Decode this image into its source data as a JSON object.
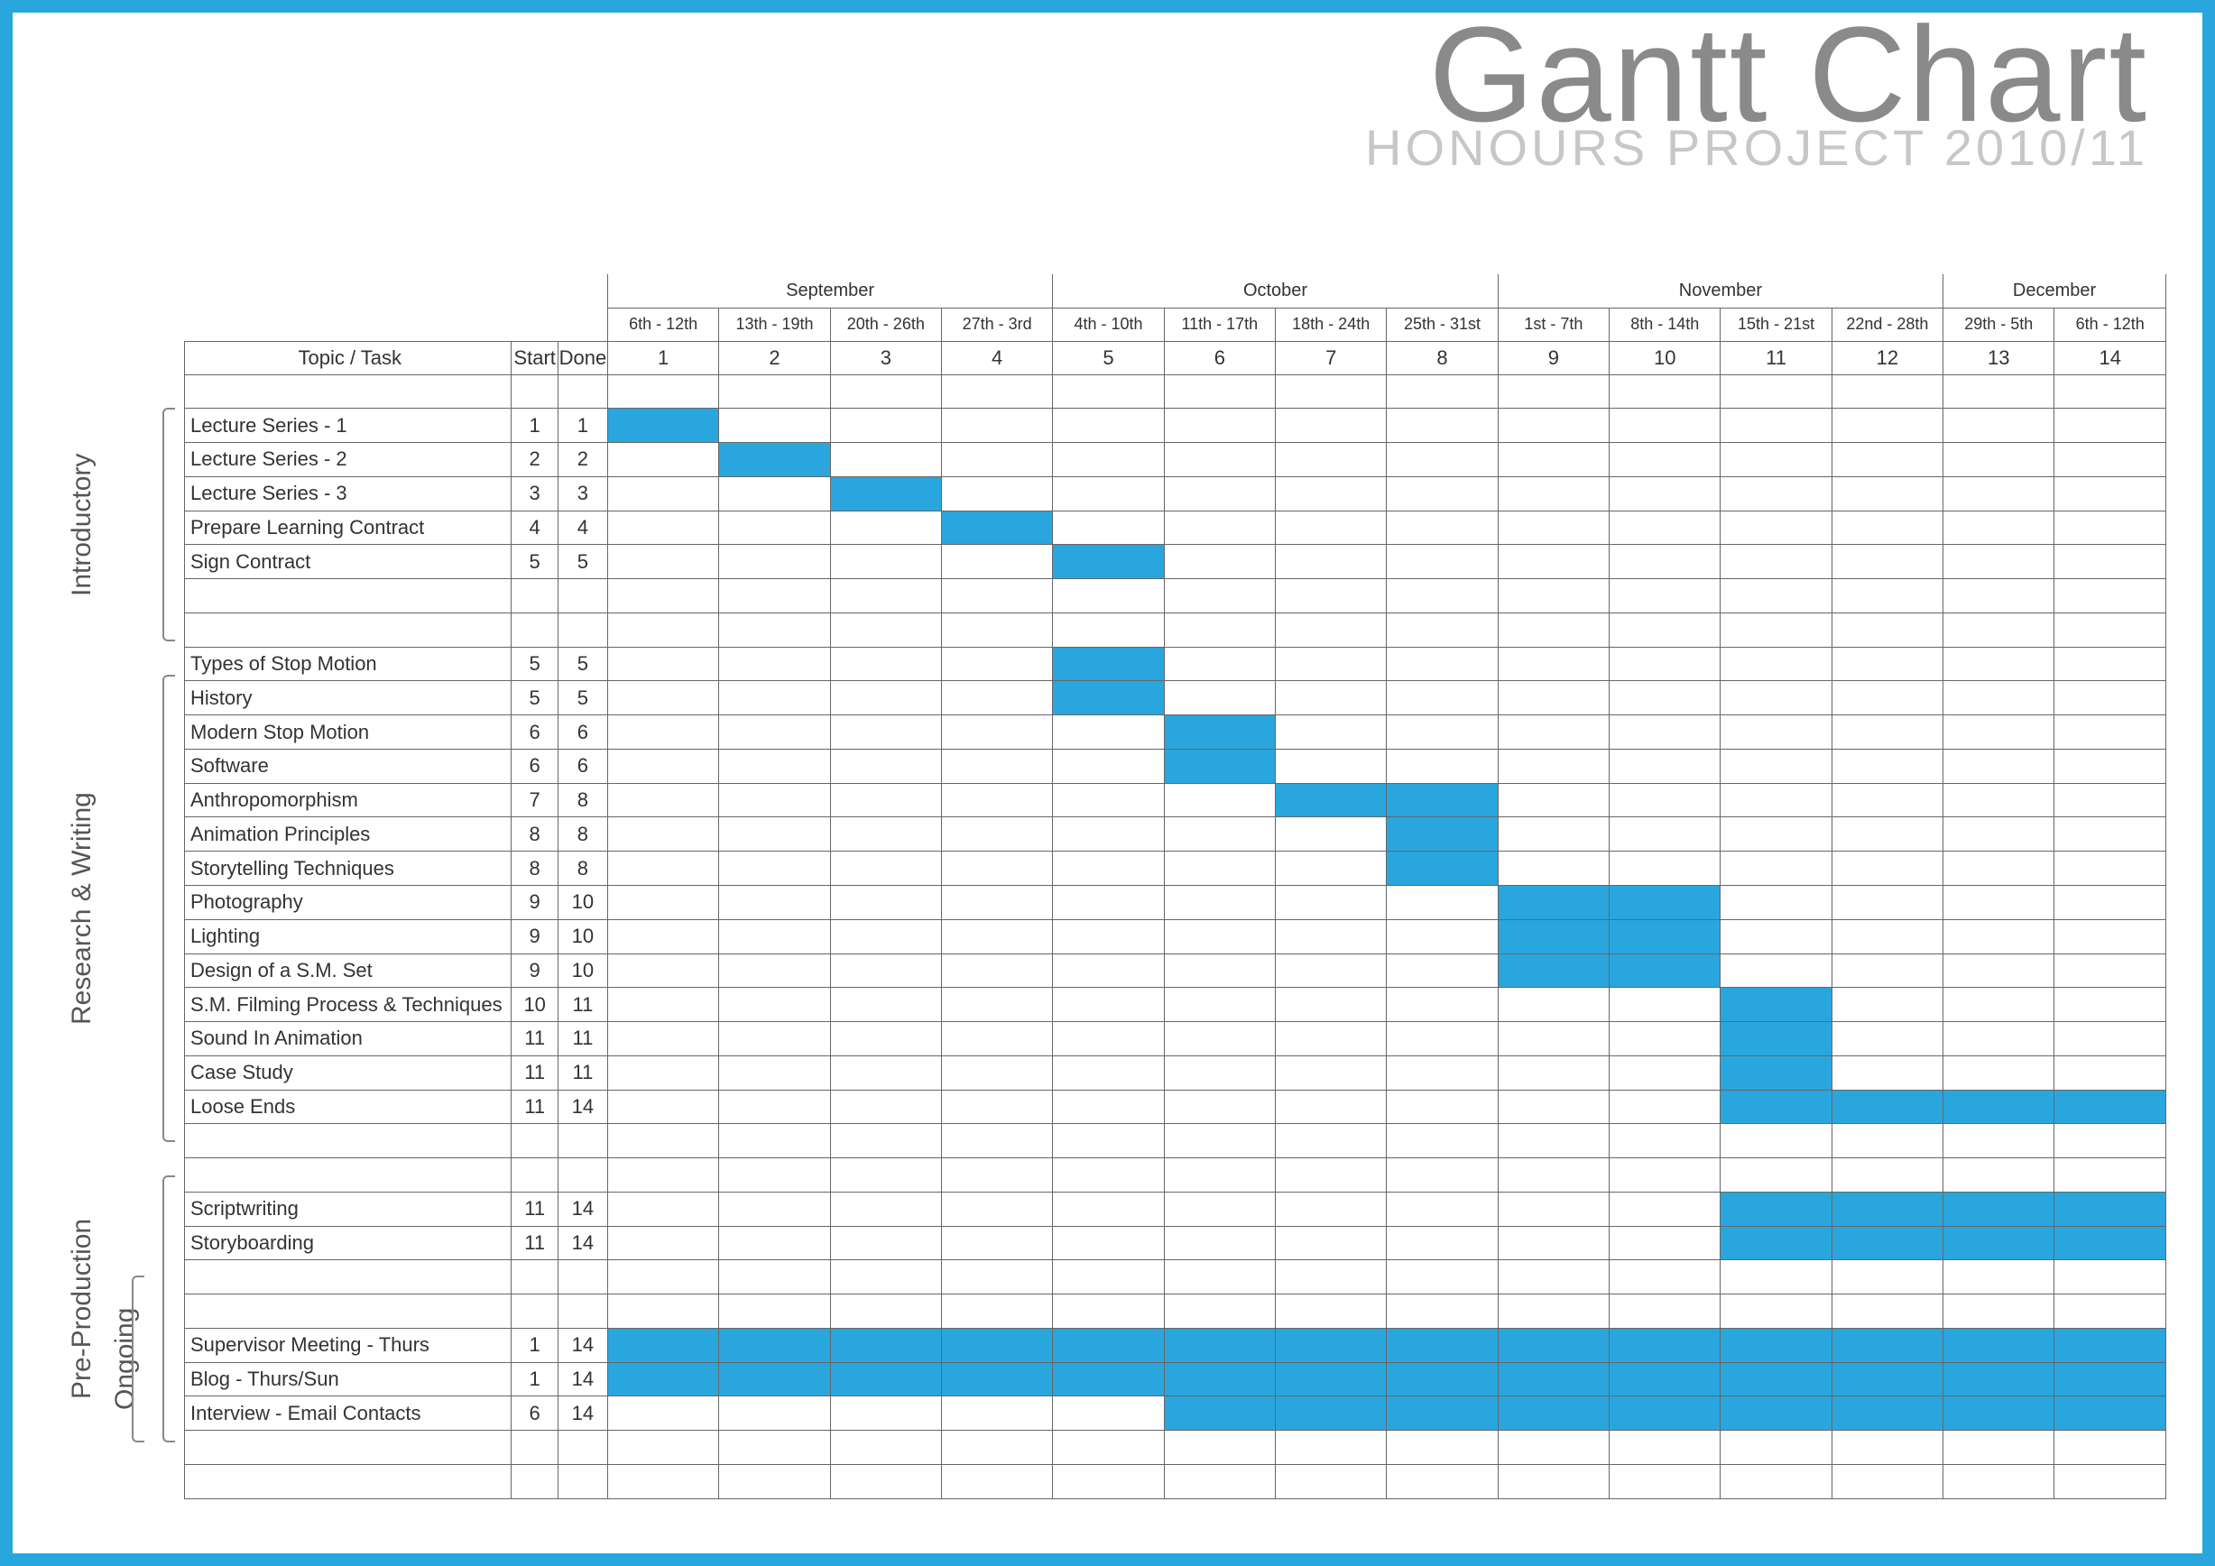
{
  "title": "Gantt Chart",
  "subtitle": "HONOURS PROJECT 2010/11",
  "header": {
    "topic_task": "Topic / Task",
    "start": "Start",
    "done": "Done"
  },
  "months": [
    {
      "name": "September",
      "span": 4
    },
    {
      "name": "October",
      "span": 4
    },
    {
      "name": "November",
      "span": 4
    },
    {
      "name": "December",
      "span": 2
    }
  ],
  "week_ranges": [
    "6th - 12th",
    "13th - 19th",
    "20th - 26th",
    "27th - 3rd",
    "4th - 10th",
    "11th - 17th",
    "18th - 24th",
    "25th - 31st",
    "1st - 7th",
    "8th - 14th",
    "15th - 21st",
    "22nd - 28th",
    "29th - 5th",
    "6th - 12th"
  ],
  "week_numbers": [
    1,
    2,
    3,
    4,
    5,
    6,
    7,
    8,
    9,
    10,
    11,
    12,
    13,
    14
  ],
  "phases": [
    {
      "label": "Introductory",
      "start_row": 1,
      "end_row": 7
    },
    {
      "label": "Research & Writing",
      "start_row": 9,
      "end_row": 22
    },
    {
      "label": "Pre-Production",
      "start_row": 24,
      "end_row": 31
    },
    {
      "label": "Ongoing",
      "start_row": 27,
      "end_row": 31
    }
  ],
  "rows": [
    {
      "type": "spacer"
    },
    {
      "task": "Lecture Series - 1",
      "start": 1,
      "done": 1,
      "bar": [
        1,
        1
      ]
    },
    {
      "task": "Lecture Series - 2",
      "start": 2,
      "done": 2,
      "bar": [
        2,
        2
      ]
    },
    {
      "task": "Lecture Series - 3",
      "start": 3,
      "done": 3,
      "bar": [
        3,
        3
      ]
    },
    {
      "task": "Prepare Learning Contract",
      "start": 4,
      "done": 4,
      "bar": [
        4,
        4
      ]
    },
    {
      "task": "Sign Contract",
      "start": 5,
      "done": 5,
      "bar": [
        5,
        5
      ]
    },
    {
      "type": "spacer"
    },
    {
      "type": "spacer"
    },
    {
      "task": "Types of Stop Motion",
      "start": 5,
      "done": 5,
      "bar": [
        5,
        5
      ]
    },
    {
      "task": "History",
      "start": 5,
      "done": 5,
      "bar": [
        5,
        5
      ]
    },
    {
      "task": "Modern Stop Motion",
      "start": 6,
      "done": 6,
      "bar": [
        6,
        6
      ]
    },
    {
      "task": "Software",
      "start": 6,
      "done": 6,
      "bar": [
        6,
        6
      ]
    },
    {
      "task": "Anthropomorphism",
      "start": 7,
      "done": 8,
      "bar": [
        7,
        8
      ]
    },
    {
      "task": "Animation Principles",
      "start": 8,
      "done": 8,
      "bar": [
        8,
        8
      ]
    },
    {
      "task": "Storytelling Techniques",
      "start": 8,
      "done": 8,
      "bar": [
        8,
        8
      ]
    },
    {
      "task": "Photography",
      "start": 9,
      "done": 10,
      "bar": [
        9,
        10
      ]
    },
    {
      "task": "Lighting",
      "start": 9,
      "done": 10,
      "bar": [
        9,
        10
      ]
    },
    {
      "task": "Design of a S.M. Set",
      "start": 9,
      "done": 10,
      "bar": [
        9,
        10
      ]
    },
    {
      "task": "S.M. Filming Process & Techniques",
      "start": 10,
      "done": 11,
      "bar": [
        11,
        11
      ]
    },
    {
      "task": "Sound In Animation",
      "start": 11,
      "done": 11,
      "bar": [
        11,
        11
      ]
    },
    {
      "task": "Case Study",
      "start": 11,
      "done": 11,
      "bar": [
        11,
        11
      ]
    },
    {
      "task": "Loose Ends",
      "start": 11,
      "done": 14,
      "bar": [
        11,
        14
      ]
    },
    {
      "type": "spacer"
    },
    {
      "type": "spacer"
    },
    {
      "task": "Scriptwriting",
      "start": 11,
      "done": 14,
      "bar": [
        11,
        14
      ]
    },
    {
      "task": "Storyboarding",
      "start": 11,
      "done": 14,
      "bar": [
        11,
        14
      ]
    },
    {
      "type": "spacer"
    },
    {
      "type": "spacer"
    },
    {
      "task": "Supervisor Meeting - Thurs",
      "start": 1,
      "done": 14,
      "bar": [
        1,
        14
      ]
    },
    {
      "task": "Blog - Thurs/Sun",
      "start": 1,
      "done": 14,
      "bar": [
        1,
        14
      ]
    },
    {
      "task": "Interview - Email Contacts",
      "start": 6,
      "done": 14,
      "bar": [
        6,
        14
      ]
    },
    {
      "type": "spacer"
    },
    {
      "type": "spacer"
    }
  ],
  "chart_data": {
    "type": "gantt",
    "title": "Gantt Chart — Honours Project 2010/11",
    "x_unit": "week",
    "x_range": [
      1,
      14
    ],
    "week_date_ranges": [
      "6th-12th Sep",
      "13th-19th Sep",
      "20th-26th Sep",
      "27th Sep-3rd Oct",
      "4th-10th Oct",
      "11th-17th Oct",
      "18th-24th Oct",
      "25th-31st Oct",
      "1st-7th Nov",
      "8th-14th Nov",
      "15th-21st Nov",
      "22nd-28th Nov",
      "29th Nov-5th Dec",
      "6th-12th Dec"
    ],
    "tasks": [
      {
        "phase": "Introductory",
        "name": "Lecture Series - 1",
        "start": 1,
        "end": 1
      },
      {
        "phase": "Introductory",
        "name": "Lecture Series - 2",
        "start": 2,
        "end": 2
      },
      {
        "phase": "Introductory",
        "name": "Lecture Series - 3",
        "start": 3,
        "end": 3
      },
      {
        "phase": "Introductory",
        "name": "Prepare Learning Contract",
        "start": 4,
        "end": 4
      },
      {
        "phase": "Introductory",
        "name": "Sign Contract",
        "start": 5,
        "end": 5
      },
      {
        "phase": "Research & Writing",
        "name": "Types of Stop Motion",
        "start": 5,
        "end": 5
      },
      {
        "phase": "Research & Writing",
        "name": "History",
        "start": 5,
        "end": 5
      },
      {
        "phase": "Research & Writing",
        "name": "Modern Stop Motion",
        "start": 6,
        "end": 6
      },
      {
        "phase": "Research & Writing",
        "name": "Software",
        "start": 6,
        "end": 6
      },
      {
        "phase": "Research & Writing",
        "name": "Anthropomorphism",
        "start": 7,
        "end": 8
      },
      {
        "phase": "Research & Writing",
        "name": "Animation Principles",
        "start": 8,
        "end": 8
      },
      {
        "phase": "Research & Writing",
        "name": "Storytelling Techniques",
        "start": 8,
        "end": 8
      },
      {
        "phase": "Research & Writing",
        "name": "Photography",
        "start": 9,
        "end": 10
      },
      {
        "phase": "Research & Writing",
        "name": "Lighting",
        "start": 9,
        "end": 10
      },
      {
        "phase": "Research & Writing",
        "name": "Design of a S.M. Set",
        "start": 9,
        "end": 10
      },
      {
        "phase": "Research & Writing",
        "name": "S.M. Filming Process & Techniques",
        "start": 10,
        "end": 11
      },
      {
        "phase": "Research & Writing",
        "name": "Sound In Animation",
        "start": 11,
        "end": 11
      },
      {
        "phase": "Research & Writing",
        "name": "Case Study",
        "start": 11,
        "end": 11
      },
      {
        "phase": "Research & Writing",
        "name": "Loose Ends",
        "start": 11,
        "end": 14
      },
      {
        "phase": "Pre-Production",
        "name": "Scriptwriting",
        "start": 11,
        "end": 14
      },
      {
        "phase": "Pre-Production",
        "name": "Storyboarding",
        "start": 11,
        "end": 14
      },
      {
        "phase": "Ongoing",
        "name": "Supervisor Meeting - Thurs",
        "start": 1,
        "end": 14
      },
      {
        "phase": "Ongoing",
        "name": "Blog - Thurs/Sun",
        "start": 1,
        "end": 14
      },
      {
        "phase": "Ongoing",
        "name": "Interview - Email Contacts",
        "start": 6,
        "end": 14
      }
    ]
  }
}
